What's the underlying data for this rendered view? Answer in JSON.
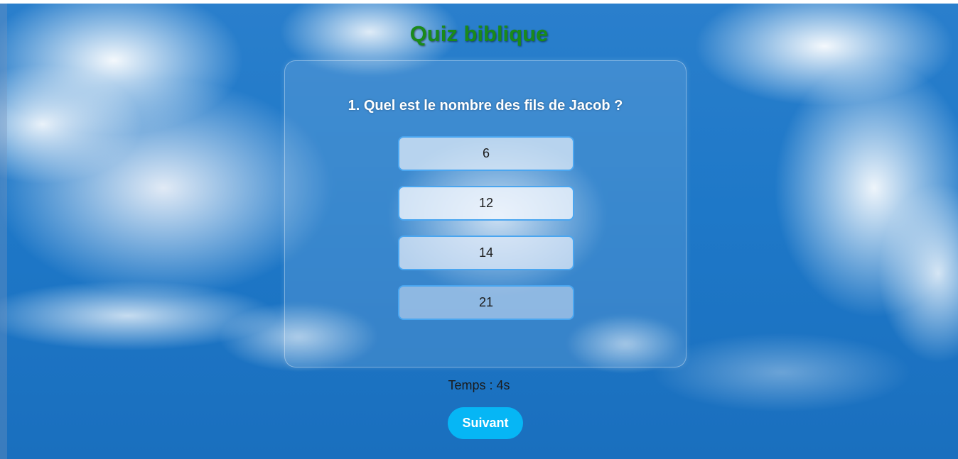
{
  "app": {
    "title": "Quiz biblique"
  },
  "quiz": {
    "question": "1. Quel est le nombre des fils de Jacob ?",
    "answers": [
      "6",
      "12",
      "14",
      "21"
    ],
    "timer": "Temps : 4s",
    "next_label": "Suivant"
  },
  "colors": {
    "title": "#1a8a1a",
    "answer_border": "#4aa6f0",
    "next_button": "#06b6f5",
    "sky": "#1e78c8"
  }
}
